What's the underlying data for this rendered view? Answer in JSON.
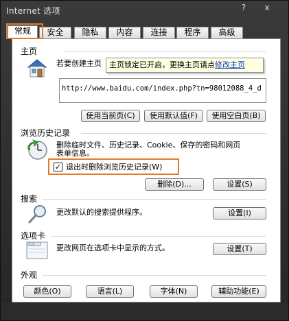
{
  "window": {
    "title": "Internet 选项",
    "help": "?",
    "close": "x"
  },
  "tabs": [
    {
      "label": "常规",
      "active": true
    },
    {
      "label": "安全"
    },
    {
      "label": "隐私"
    },
    {
      "label": "内容"
    },
    {
      "label": "连接"
    },
    {
      "label": "程序"
    },
    {
      "label": "高级"
    }
  ],
  "home": {
    "title": "主页",
    "desc": "若要创建主页",
    "tooltip_text": "主页锁定已开启，更换主页请点",
    "tooltip_link": "修改主页",
    "url": "http://www.baidu.com/index.php?tn=98012088_4_d",
    "buttons": {
      "current": "使用当前页(C)",
      "default": "使用默认值(F)",
      "blank": "使用空白页(B)"
    }
  },
  "history": {
    "title": "浏览历史记录",
    "desc_line1": "删除临时文件、历史记录、Cookie、保存的密码和网页",
    "desc_line2": "表单信息。",
    "checkbox_label": "退出时删除浏览历史记录(W)",
    "checkbox_checked": true,
    "checkbox_mark": "✓",
    "delete": "删除(D)...",
    "settings": "设置(S)"
  },
  "search": {
    "title": "搜索",
    "desc": "更改默认的搜索提供程序。",
    "settings": "设置(I)"
  },
  "tabsgroup": {
    "title": "选项卡",
    "desc": "更改网页在选项卡中显示的方式。",
    "settings": "设置(T)"
  },
  "appearance": {
    "title": "外观",
    "colors": "颜色(O)",
    "languages": "语言(L)",
    "fonts": "字体(N)",
    "accessibility": "辅助功能(E)"
  },
  "colors": {
    "highlight": "#e07b2c",
    "link": "#0033cc",
    "tooltip_bg": "#ffffe1"
  }
}
